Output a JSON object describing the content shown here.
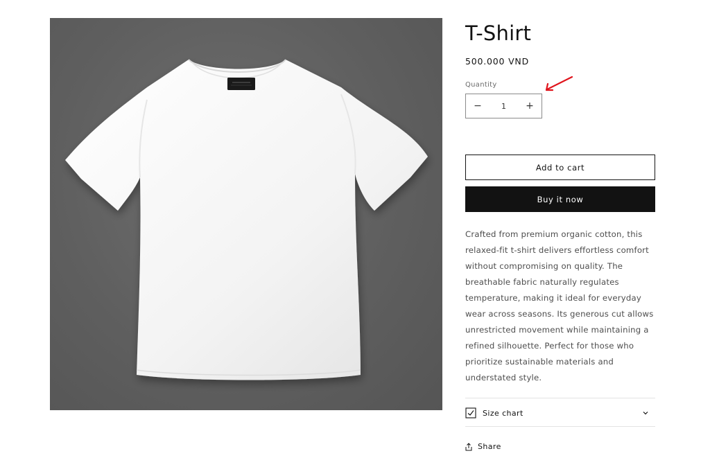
{
  "product": {
    "title": "T-Shirt",
    "price": "500.000 VND",
    "image_alt": "White t-shirt on gray background"
  },
  "quantity": {
    "label": "Quantity",
    "value": "1",
    "minus_symbol": "−",
    "plus_symbol": "+"
  },
  "actions": {
    "add_to_cart": "Add to cart",
    "buy_now": "Buy it now"
  },
  "description": "Crafted from premium organic cotton, this relaxed-fit t-shirt delivers effortless comfort without compromising on quality. The breathable fabric naturally regulates temperature, making it ideal for everyday wear across seasons. Its generous cut allows unrestricted movement while maintaining a refined silhouette. Perfect for those who prioritize sustainable materials and understated style.",
  "size_chart": {
    "label": "Size chart",
    "icon": "ruler-check-icon",
    "expand_icon": "chevron-down-icon"
  },
  "share": {
    "label": "Share",
    "icon": "share-icon"
  },
  "colors": {
    "text": "#121212",
    "muted": "#4d4d4d",
    "accent_arrow": "#e0141c",
    "buy_bg": "#121212",
    "image_bg": "#606060"
  }
}
